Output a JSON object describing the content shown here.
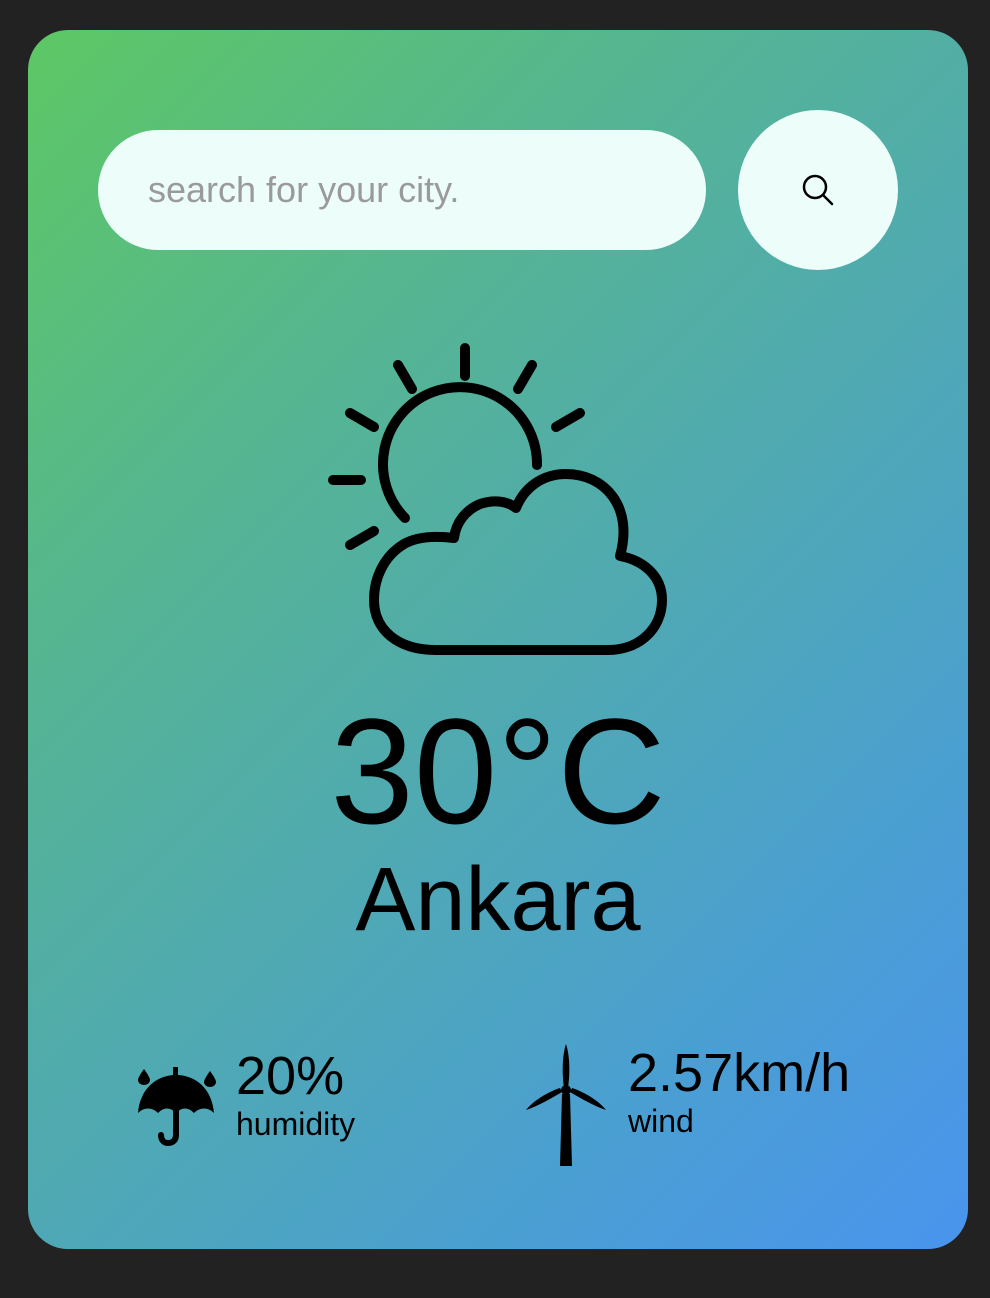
{
  "search": {
    "placeholder": "search for your city.",
    "value": ""
  },
  "icons": {
    "search_button": "search-icon",
    "weather": "partly-cloudy-icon",
    "humidity": "umbrella-rain-icon",
    "wind": "wind-turbine-icon"
  },
  "weather": {
    "temperature": "30°C",
    "city": "Ankara"
  },
  "details": {
    "humidity": {
      "value": "20%",
      "label": "humidity"
    },
    "wind": {
      "value": "2.57km/h",
      "label": "wind"
    }
  },
  "colors": {
    "background": "#222222",
    "gradient_start": "#5dc864",
    "gradient_end": "#4a94ee",
    "input_background": "#ecfdfa",
    "placeholder": "#9a9a9a"
  }
}
